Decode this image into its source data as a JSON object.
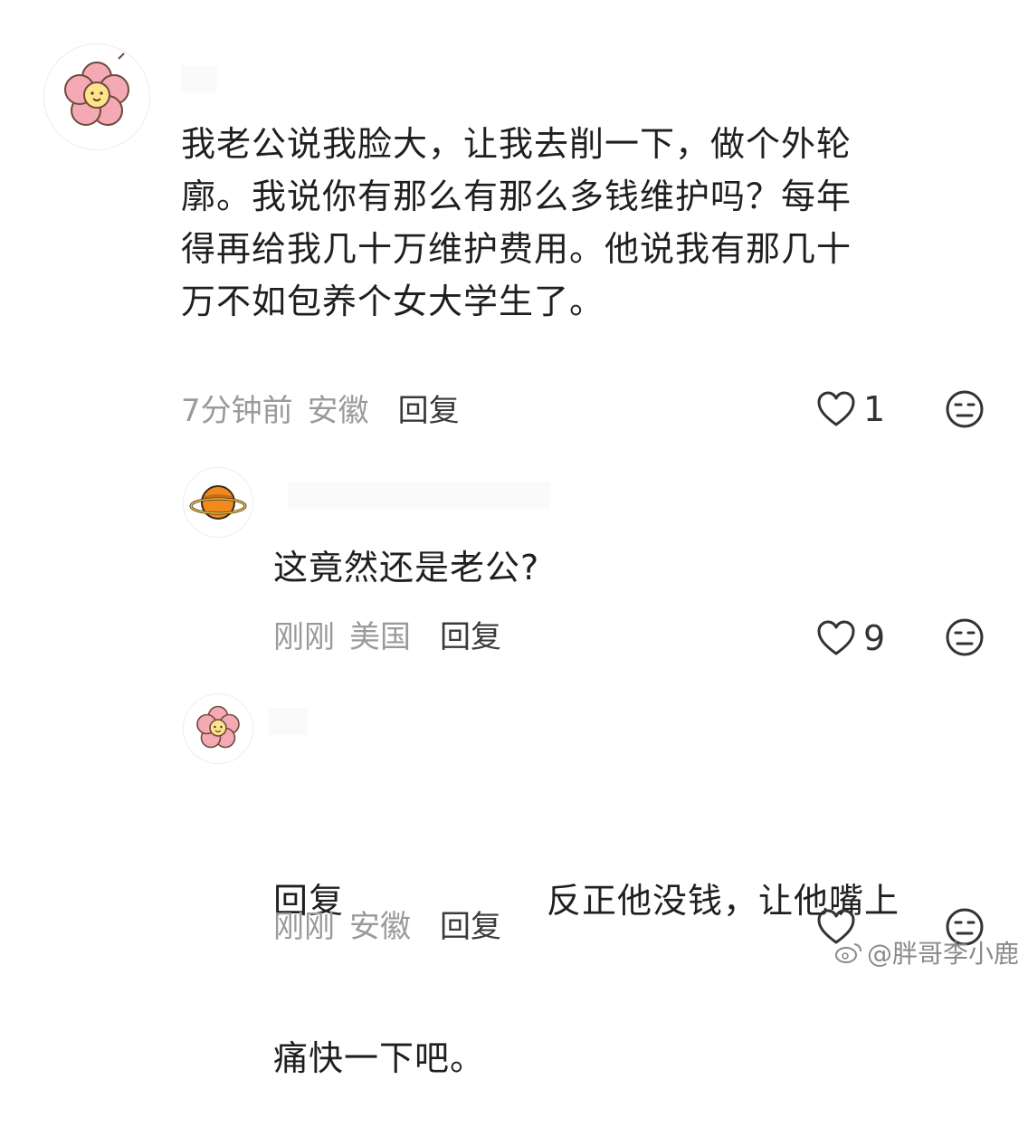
{
  "comments": [
    {
      "text": "我老公说我脸大，让我去削一下，做个外轮\n廓。我说你有那么有那么多钱维护吗？每年\n得再给我几十万维护费用。他说我有那几十\n万不如包养个女大学生了。",
      "time": "7分钟前",
      "location": "安徽",
      "reply_label": "回复",
      "likes": "1",
      "avatar_icon": "flower-icon"
    },
    {
      "text": "这竟然还是老公?",
      "time": "刚刚",
      "location": "美国",
      "reply_label": "回复",
      "likes": "9",
      "avatar_icon": "planet-icon"
    },
    {
      "reply_prefix": "回复",
      "text_line1": "反正他没钱，让他嘴上",
      "text_line2": "痛快一下吧。",
      "time": "刚刚",
      "location": "安徽",
      "reply_label": "回复",
      "likes": "",
      "avatar_icon": "flower-icon"
    }
  ],
  "watermark": "@胖哥李小鹿",
  "colors": {
    "text": "#1f1f1f",
    "meta": "#9a9a9a",
    "icon": "#333333"
  }
}
